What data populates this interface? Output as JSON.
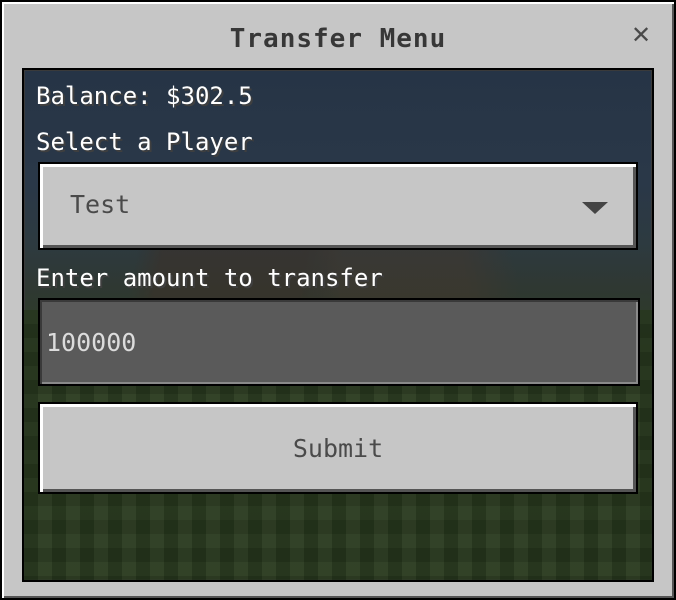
{
  "window": {
    "title": "Transfer Menu",
    "close_icon": "close-icon"
  },
  "form": {
    "balance_text": "Balance: $302.5",
    "select_label": "Select a Player",
    "selected_player": "Test",
    "dropdown_icon": "caret-down-icon",
    "amount_label": "Enter amount to transfer",
    "amount_value": "100000",
    "submit_label": "Submit"
  },
  "colors": {
    "panel": "#c6c6c6",
    "input_background": "#5a5a5a",
    "label_text": "#ffffff",
    "title_text": "#373737"
  }
}
